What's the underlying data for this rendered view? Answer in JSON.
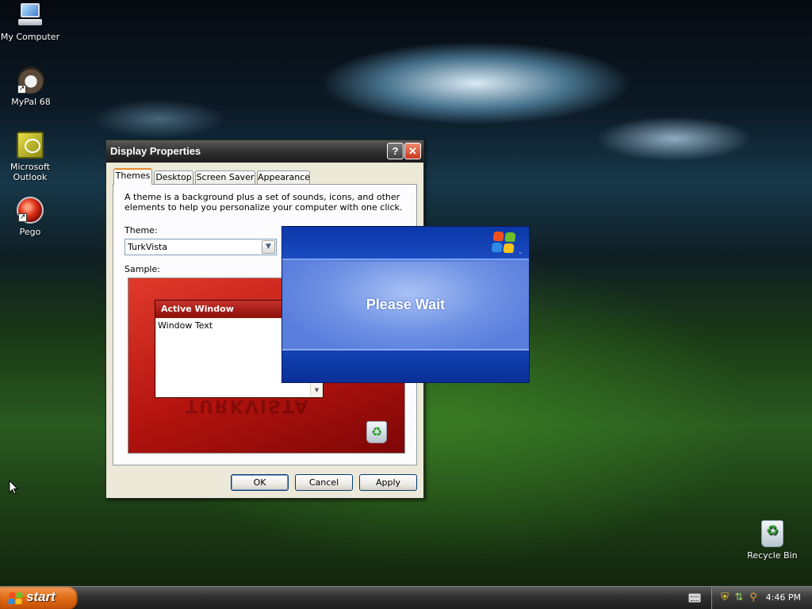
{
  "desktop": {
    "icons": [
      {
        "label": "My Computer",
        "icon": "computer-icon"
      },
      {
        "label": "MyPal 68",
        "icon": "mypal-browser-icon"
      },
      {
        "label": "Microsoft Outlook",
        "icon": "outlook-icon"
      },
      {
        "label": "Pego",
        "icon": "pego-icon"
      },
      {
        "label": "Recycle Bin",
        "icon": "recycle-bin-icon"
      }
    ]
  },
  "display_properties": {
    "title": "Display Properties",
    "help_glyph": "?",
    "close_glyph": "✕",
    "tabs": [
      {
        "label": "Themes",
        "active": true
      },
      {
        "label": "Desktop",
        "active": false
      },
      {
        "label": "Screen Saver",
        "active": false
      },
      {
        "label": "Appearance",
        "active": false
      }
    ],
    "description": "A theme is a background plus a set of sounds, icons, and other elements to help you personalize your computer with one click.",
    "theme_label": "Theme:",
    "theme_value": "TurkVista",
    "sample_label": "Sample:",
    "sample": {
      "window_title": "Active Window",
      "window_text": "Window Text"
    },
    "buttons": {
      "ok": "OK",
      "cancel": "Cancel",
      "apply": "Apply"
    }
  },
  "please_wait": {
    "message": "Please Wait",
    "trademark": "™"
  },
  "taskbar": {
    "start_label": "start",
    "clock": "4:46 PM",
    "tray_icons": [
      "keyboard-icon",
      "security-shield-icon",
      "network-icon",
      "search-icon"
    ]
  },
  "colors": {
    "taskbar": "#2f2f2f",
    "start_button": "#e06a15",
    "sample_theme_red": "#c01a14",
    "please_wait_blue": "#1b4bc0"
  }
}
